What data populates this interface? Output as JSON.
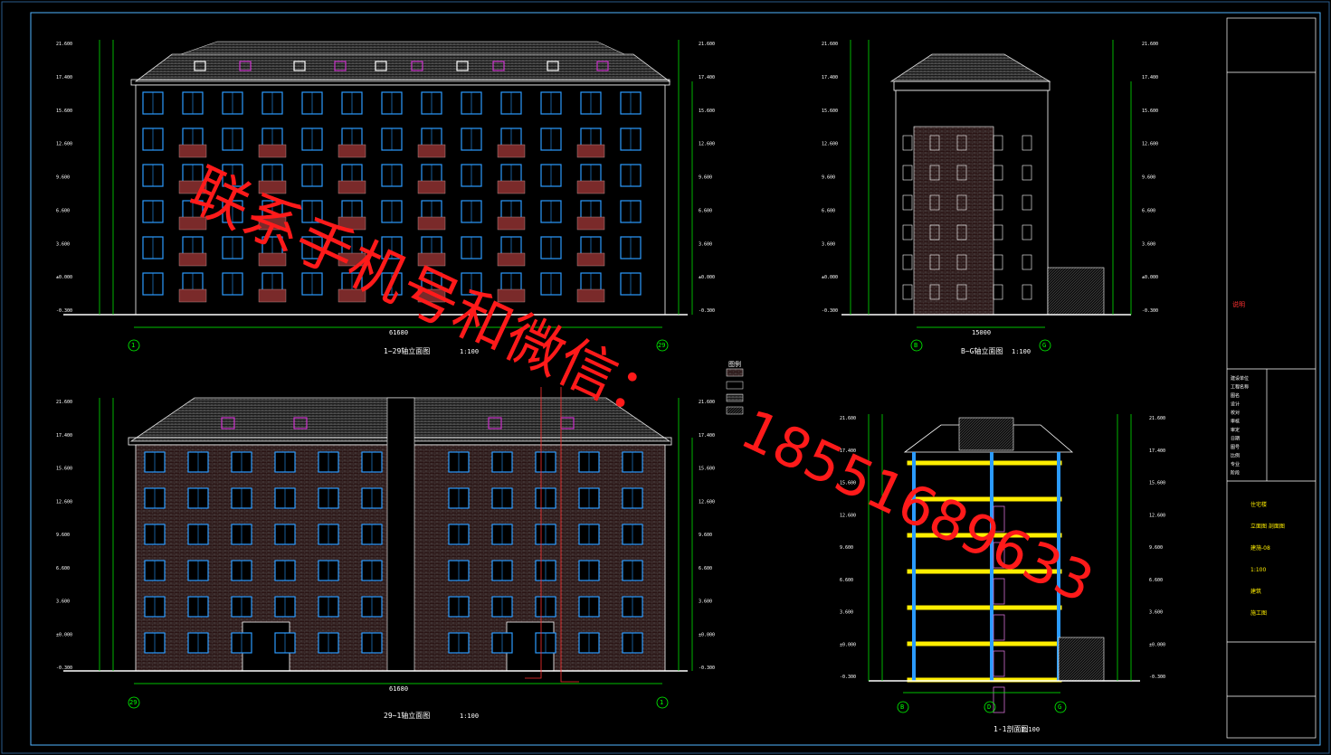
{
  "drawing": {
    "views": [
      {
        "id": "front",
        "title": "1~29轴立面图",
        "scale": "1:100",
        "axis_left": "1",
        "axis_right": "29"
      },
      {
        "id": "side",
        "title": "B~G轴立面图",
        "scale": "1:100",
        "axis_left": "B",
        "axis_right": "G"
      },
      {
        "id": "back",
        "title": "29~1轴立面图",
        "scale": "1:100",
        "axis_left": "29",
        "axis_right": "1"
      },
      {
        "id": "section",
        "title": "1-1剖面图",
        "scale": "1:100",
        "axis_left": "B",
        "axis_mid": "D",
        "axis_right": "G"
      }
    ],
    "elevation_marks": [
      "21.600",
      "17.400",
      "15.600",
      "12.600",
      "9.600",
      "6.600",
      "3.600",
      "±0.000",
      "-0.300"
    ],
    "dims": {
      "front_width": "61680",
      "side_width": "15000",
      "back_width": "61680"
    },
    "legend_title": "图例",
    "notes_title": "说明"
  },
  "title_block": {
    "rows": [
      "建设单位",
      "工程名称",
      "图名",
      "设计",
      "校对",
      "审核",
      "审定",
      "日期",
      "图号",
      "比例",
      "专业",
      "阶段"
    ],
    "values": [
      "住宅楼",
      "立面图 剖面图",
      "建施-08",
      "1:100",
      "建筑",
      "施工图"
    ]
  },
  "watermark": {
    "line1": "联系手机号和微信：",
    "line2": "18551689633"
  },
  "colors": {
    "bg": "#000000",
    "frame": "#4fb3ff",
    "dim": "#00ff00",
    "wall": "#ffffff",
    "window": "#2b9bff",
    "brick": "#7a2a2a",
    "roof": "#a0a0a0",
    "dormer": "#cc33cc",
    "slab": "#ffee00",
    "watermark": "#ff1a1a"
  }
}
